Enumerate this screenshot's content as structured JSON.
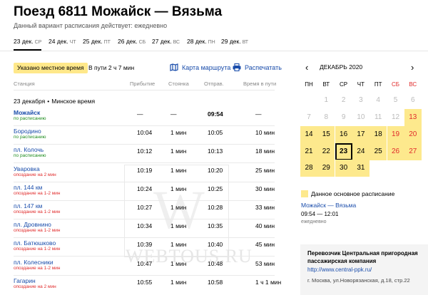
{
  "header": {
    "title": "Поезд 6811 Можайск — Вязьма",
    "subtitle": "Данный вариант расписания действует: ежедневно"
  },
  "date_tabs": [
    {
      "date": "23 дек.",
      "dow": "СР",
      "active": true
    },
    {
      "date": "24 дек.",
      "dow": "ЧТ"
    },
    {
      "date": "25 дек.",
      "dow": "ПТ"
    },
    {
      "date": "26 дек.",
      "dow": "СБ"
    },
    {
      "date": "27 дек.",
      "dow": "ВС"
    },
    {
      "date": "28 дек.",
      "dow": "ПН"
    },
    {
      "date": "29 дек.",
      "dow": "ВТ"
    }
  ],
  "toolbar": {
    "local_time_label": "Указано местное время",
    "travel_time": "В пути 2 ч 7 мин",
    "map_label": "Карта маршрута",
    "print_label": "Распечатать"
  },
  "table": {
    "headers": {
      "station": "Станция",
      "arrival": "Прибытие",
      "stop": "Стоянка",
      "departure": "Отправ.",
      "travel": "Время в пути"
    },
    "section_date": "23 декабря",
    "section_tz": "Минское время",
    "rows": [
      {
        "name": "Можайск",
        "note": "по расписанию",
        "late": false,
        "arr": "—",
        "stop": "—",
        "dep": "09:54",
        "trip": "—",
        "bold": true
      },
      {
        "name": "Бородино",
        "note": "по расписанию",
        "late": false,
        "arr": "10:04",
        "stop": "1 мин",
        "dep": "10:05",
        "trip": "10 мин"
      },
      {
        "name": "пл. Колочь",
        "note": "по расписанию",
        "late": false,
        "arr": "10:12",
        "stop": "1 мин",
        "dep": "10:13",
        "trip": "18 мин"
      },
      {
        "name": "Уваровка",
        "note": "опоздание на 2 мин",
        "late": true,
        "arr": "10:19",
        "stop": "1 мин",
        "dep": "10:20",
        "trip": "25 мин"
      },
      {
        "name": "пл. 144 км",
        "note": "опоздание на 1-2 мин",
        "late": true,
        "arr": "10:24",
        "stop": "1 мин",
        "dep": "10:25",
        "trip": "30 мин"
      },
      {
        "name": "пл. 147 км",
        "note": "опоздание на 1-2 мин",
        "late": true,
        "arr": "10:27",
        "stop": "1 мин",
        "dep": "10:28",
        "trip": "33 мин"
      },
      {
        "name": "пл. Дровнино",
        "note": "опоздание на 1-2 мин",
        "late": true,
        "arr": "10:34",
        "stop": "1 мин",
        "dep": "10:35",
        "trip": "40 мин"
      },
      {
        "name": "пл. Батюшково",
        "note": "опоздание на 1-2 мин",
        "late": true,
        "arr": "10:39",
        "stop": "1 мин",
        "dep": "10:40",
        "trip": "45 мин"
      },
      {
        "name": "пл. Колесники",
        "note": "опоздание на 1-2 мин",
        "late": true,
        "arr": "10:47",
        "stop": "1 мин",
        "dep": "10:48",
        "trip": "53 мин"
      },
      {
        "name": "Гагарин",
        "note": "опоздание на 2 мин",
        "late": true,
        "arr": "10:55",
        "stop": "1 мин",
        "dep": "10:58",
        "trip": "1 ч 1 мин"
      }
    ]
  },
  "watermark": "WEBTOUS.RU",
  "calendar": {
    "month": "ДЕКАБРЬ 2020",
    "prev_icon": "‹",
    "next_icon": "›",
    "weekdays": [
      "ПН",
      "ВТ",
      "СР",
      "ЧТ",
      "ПТ",
      "СБ",
      "ВС"
    ],
    "weeks": [
      [
        {
          "d": "",
          "s": ""
        },
        {
          "d": "1",
          "s": "past"
        },
        {
          "d": "2",
          "s": "past"
        },
        {
          "d": "3",
          "s": "past"
        },
        {
          "d": "4",
          "s": "past"
        },
        {
          "d": "5",
          "s": "past"
        },
        {
          "d": "6",
          "s": "past"
        }
      ],
      [
        {
          "d": "7",
          "s": "past"
        },
        {
          "d": "8",
          "s": "past"
        },
        {
          "d": "9",
          "s": "past"
        },
        {
          "d": "10",
          "s": "past"
        },
        {
          "d": "11",
          "s": "past"
        },
        {
          "d": "12",
          "s": "past"
        },
        {
          "d": "13",
          "s": "avail wkend"
        }
      ],
      [
        {
          "d": "14",
          "s": "avail"
        },
        {
          "d": "15",
          "s": "avail"
        },
        {
          "d": "16",
          "s": "avail"
        },
        {
          "d": "17",
          "s": "avail"
        },
        {
          "d": "18",
          "s": "avail"
        },
        {
          "d": "19",
          "s": "avail wkend"
        },
        {
          "d": "20",
          "s": "avail wkend"
        }
      ],
      [
        {
          "d": "21",
          "s": "avail"
        },
        {
          "d": "22",
          "s": "avail"
        },
        {
          "d": "23",
          "s": "avail selected"
        },
        {
          "d": "24",
          "s": "avail"
        },
        {
          "d": "25",
          "s": "avail"
        },
        {
          "d": "26",
          "s": "avail wkend"
        },
        {
          "d": "27",
          "s": "avail wkend"
        }
      ],
      [
        {
          "d": "28",
          "s": "avail"
        },
        {
          "d": "29",
          "s": "avail"
        },
        {
          "d": "30",
          "s": "avail"
        },
        {
          "d": "31",
          "s": "avail"
        },
        {
          "d": "",
          "s": ""
        },
        {
          "d": "",
          "s": ""
        },
        {
          "d": "",
          "s": ""
        }
      ]
    ]
  },
  "legend": {
    "text": "Данное основное расписание",
    "route": "Можайск — Вязьма",
    "times": "09:54 — 12:01",
    "freq": "ежедневно"
  },
  "carrier": {
    "name": "Перевозчик Центральная пригородная пассажирская компания",
    "link": "http://www.central-ppk.ru/",
    "address": "г. Москва, ул.Новорязанская, д.18, стр.22"
  },
  "colors": {
    "accent_yellow": "#fde98d",
    "link_blue": "#1a4dab",
    "late_red": "#e02b2b",
    "ok_green": "#1e8c1e"
  }
}
